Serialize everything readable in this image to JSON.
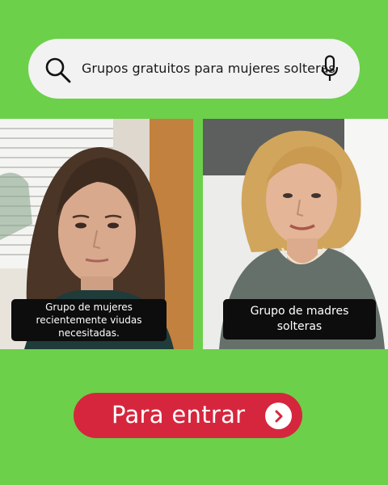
{
  "search": {
    "query": "Grupos gratuitos para mujeres solteras",
    "search_icon": "search-icon",
    "mic_icon": "microphone-icon"
  },
  "cards": [
    {
      "caption": "Grupo de mujeres recientemente viudas necesitadas."
    },
    {
      "caption": "Grupo de madres solteras"
    }
  ],
  "cta": {
    "label": "Para entrar",
    "icon": "chevron-right-icon",
    "color": "#d6263d"
  },
  "colors": {
    "background": "#6cd04a",
    "search_bar": "#f2f2f2",
    "caption_bg": "#0d0d0d"
  }
}
